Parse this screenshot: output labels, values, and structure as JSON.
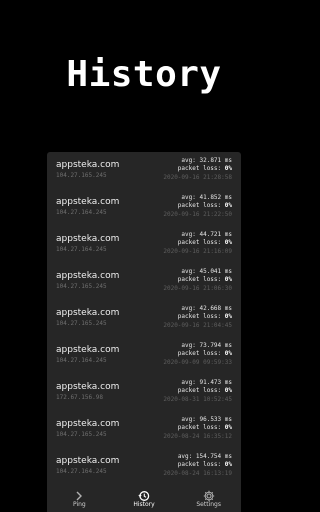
{
  "header": {
    "title": "History"
  },
  "history": [
    {
      "host": "appsteka.com",
      "ip": "104.27.165.245",
      "avg": "avg: 32.871 ms",
      "loss_prefix": "packet loss: ",
      "loss": "0%",
      "time": "2020-09-16 21:28:58"
    },
    {
      "host": "appsteka.com",
      "ip": "104.27.164.245",
      "avg": "avg: 41.852 ms",
      "loss_prefix": "packet loss: ",
      "loss": "0%",
      "time": "2020-09-16 21:22:50"
    },
    {
      "host": "appsteka.com",
      "ip": "104.27.164.245",
      "avg": "avg: 44.721 ms",
      "loss_prefix": "packet loss: ",
      "loss": "0%",
      "time": "2020-09-16 21:16:09"
    },
    {
      "host": "appsteka.com",
      "ip": "104.27.165.245",
      "avg": "avg: 45.041 ms",
      "loss_prefix": "packet loss: ",
      "loss": "0%",
      "time": "2020-09-16 21:06:30"
    },
    {
      "host": "appsteka.com",
      "ip": "104.27.165.245",
      "avg": "avg: 42.668 ms",
      "loss_prefix": "packet loss: ",
      "loss": "0%",
      "time": "2020-09-16 21:04:45"
    },
    {
      "host": "appsteka.com",
      "ip": "104.27.164.245",
      "avg": "avg: 73.794 ms",
      "loss_prefix": "packet loss: ",
      "loss": "0%",
      "time": "2020-09-09 09:59:33"
    },
    {
      "host": "appsteka.com",
      "ip": "172.67.156.98",
      "avg": "avg: 91.473 ms",
      "loss_prefix": "packet loss: ",
      "loss": "0%",
      "time": "2020-08-31 10:52:45"
    },
    {
      "host": "appsteka.com",
      "ip": "104.27.165.245",
      "avg": "avg: 96.533 ms",
      "loss_prefix": "packet loss: ",
      "loss": "0%",
      "time": "2020-08-24 16:35:12"
    },
    {
      "host": "appsteka.com",
      "ip": "104.27.164.245",
      "avg": "avg: 154.754 ms",
      "loss_prefix": "packet loss: ",
      "loss": "0%",
      "time": "2020-08-24 16:13:19"
    }
  ],
  "nav": [
    {
      "label": "Ping",
      "icon": "chevron-right-icon"
    },
    {
      "label": "History",
      "icon": "history-icon"
    },
    {
      "label": "Settings",
      "icon": "gear-icon"
    }
  ],
  "colors": {
    "background": "#000000",
    "panel": "#262626",
    "text": "#ffffff",
    "muted": "#6f6f6f"
  }
}
